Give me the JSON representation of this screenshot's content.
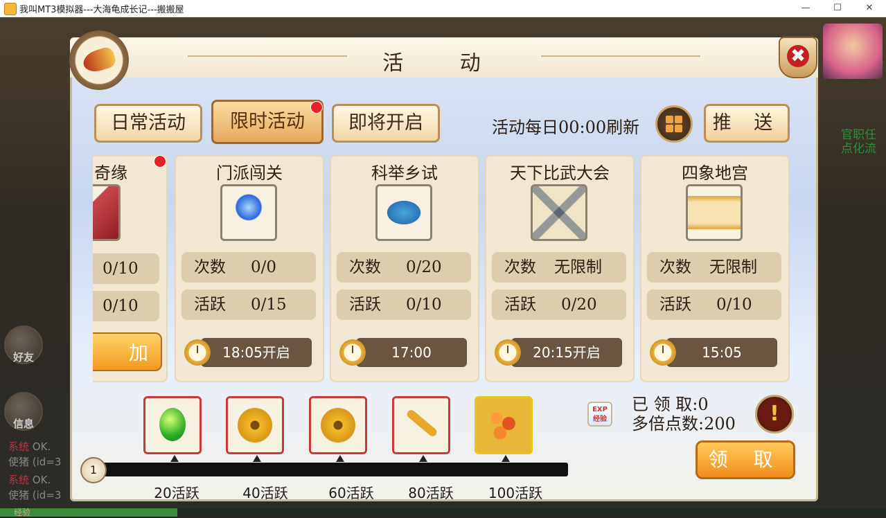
{
  "window": {
    "title": "我叫MT3模拟器---大海龟成长记---搬搬屋",
    "minimize": "—",
    "maximize": "☐",
    "close": "✕"
  },
  "side": {
    "friends": "好友",
    "messages": "信息",
    "chat": [
      {
        "tag": "系统",
        "text": "OK."
      },
      {
        "tag": "",
        "text": "使猪 (id=3"
      },
      {
        "tag": "系统",
        "text": "OK."
      },
      {
        "tag": "",
        "text": "使猪 (id=3"
      }
    ],
    "exp_label": "经验",
    "exp_progress": 0.2,
    "right_text": "官职任点化流"
  },
  "panel": {
    "title": "活 动",
    "tabs": [
      "日常活动",
      "限时活动",
      "即将开启"
    ],
    "active_tab": 1,
    "refresh_text": "活动每日00:00刷新",
    "push_label": "推 送",
    "close_icon": "✖"
  },
  "cards": [
    {
      "name": "奇缘",
      "icon": "book-icon",
      "count_key": "",
      "count": "0/10",
      "active_key": "",
      "active": "0/10",
      "join": "加",
      "partial": true
    },
    {
      "name": "门派闯关",
      "icon": "crystal-ball-icon",
      "count_key": "次数",
      "count": "0/0",
      "active_key": "活跃",
      "active": "0/15",
      "time": "18:05开启"
    },
    {
      "name": "科举乡试",
      "icon": "bowl-icon",
      "count_key": "次数",
      "count": "0/20",
      "active_key": "活跃",
      "active": "0/10",
      "time": "17:00"
    },
    {
      "name": "天下比武大会",
      "icon": "crossed-swords-icon",
      "count_key": "次数",
      "count": "无限制",
      "active_key": "活跃",
      "active": "0/20",
      "time": "20:15开启"
    },
    {
      "name": "四象地宫",
      "icon": "scroll-map-icon",
      "count_key": "次数",
      "count": "无限制",
      "active_key": "活跃",
      "active": "0/10",
      "time": "15:05"
    }
  ],
  "rewards": [
    {
      "icon": "green-gem-icon",
      "milestone": "20活跃"
    },
    {
      "icon": "gold-coin-icon",
      "milestone": "40活跃"
    },
    {
      "icon": "gold-coin-icon",
      "milestone": "60活跃"
    },
    {
      "icon": "gold-key-icon",
      "milestone": "80活跃"
    },
    {
      "icon": "gold-nuggets-icon",
      "milestone": "100活跃"
    }
  ],
  "progress": {
    "current": "1"
  },
  "summary": {
    "exp_icon_text": "EXP 经验",
    "claimed": "已 领 取:0",
    "multiplier": "多倍点数:200",
    "info_icon": "!",
    "claim_label": "领 取"
  },
  "colors": {
    "accent_orange": "#f08d1c",
    "red_dot": "#e3222a",
    "timebar": "#6a5540"
  }
}
